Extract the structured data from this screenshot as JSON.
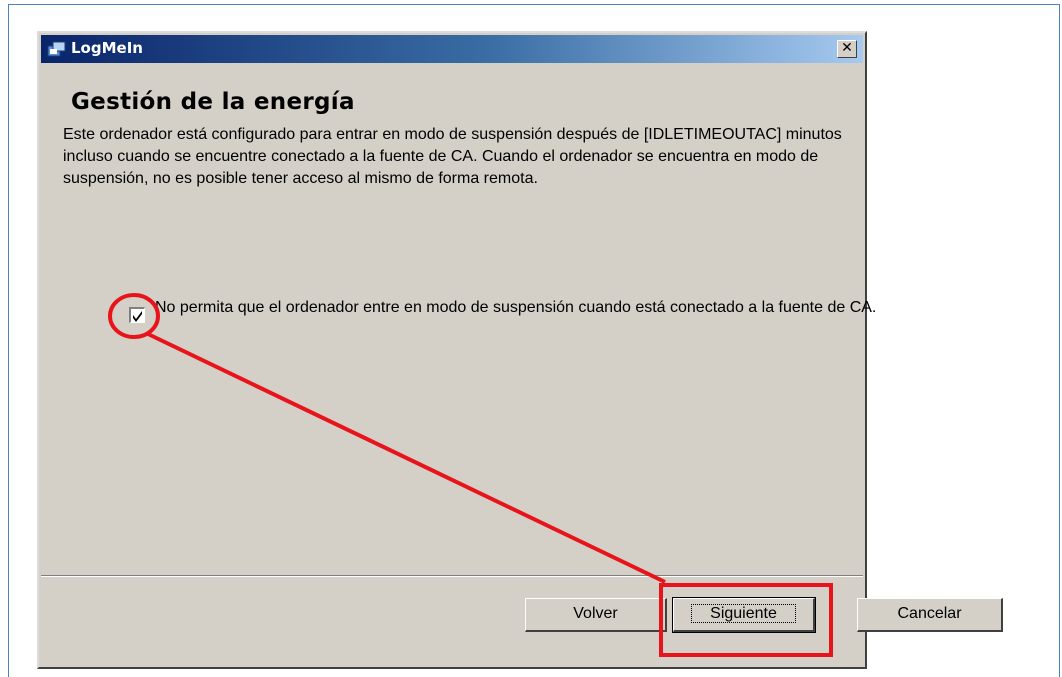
{
  "window": {
    "title": "LogMeIn",
    "close_glyph": "✕"
  },
  "page": {
    "heading": "Gestión de la energía",
    "description": "Este ordenador está configurado para entrar en modo de suspensión después de [IDLETIMEOUTAC] minutos incluso cuando se encuentre conectado a la fuente de CA. Cuando el ordenador se encuentra en modo de suspensión, no es posible tener acceso al mismo de forma remota.",
    "option": {
      "label": "No permita que el ordenador entre en modo de suspensión cuando está conectado a la fuente de CA.",
      "checked": true
    }
  },
  "buttons": {
    "back": "Volver",
    "next": "Siguiente",
    "cancel": "Cancelar"
  },
  "annotation": {
    "color": "#e8141b"
  },
  "icons": {
    "title": "setup-icon",
    "close": "close-icon",
    "check": "checkmark-icon"
  }
}
